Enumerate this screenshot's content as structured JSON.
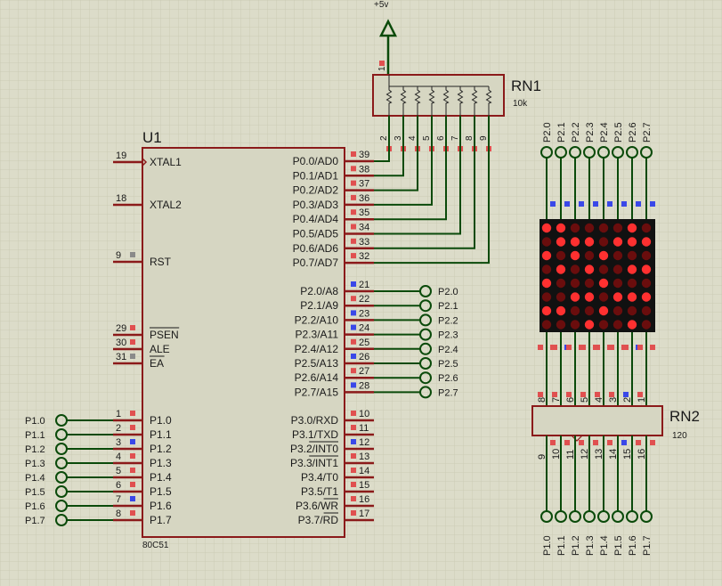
{
  "power": {
    "label": "+5v"
  },
  "u1": {
    "ref": "U1",
    "part": "80C51",
    "left_pins": [
      {
        "num": "19",
        "name": "XTAL1"
      },
      {
        "num": "18",
        "name": "XTAL2"
      },
      {
        "num": "9",
        "name": "RST"
      },
      {
        "num": "29",
        "name": "PSEN"
      },
      {
        "num": "30",
        "name": "ALE"
      },
      {
        "num": "31",
        "name": "EA"
      },
      {
        "num": "1",
        "name": "P1.0"
      },
      {
        "num": "2",
        "name": "P1.1"
      },
      {
        "num": "3",
        "name": "P1.2"
      },
      {
        "num": "4",
        "name": "P1.3"
      },
      {
        "num": "5",
        "name": "P1.4"
      },
      {
        "num": "6",
        "name": "P1.5"
      },
      {
        "num": "7",
        "name": "P1.6"
      },
      {
        "num": "8",
        "name": "P1.7"
      }
    ],
    "right_pins": [
      {
        "num": "39",
        "name": "P0.0/AD0"
      },
      {
        "num": "38",
        "name": "P0.1/AD1"
      },
      {
        "num": "37",
        "name": "P0.2/AD2"
      },
      {
        "num": "36",
        "name": "P0.3/AD3"
      },
      {
        "num": "35",
        "name": "P0.4/AD4"
      },
      {
        "num": "34",
        "name": "P0.5/AD5"
      },
      {
        "num": "33",
        "name": "P0.6/AD6"
      },
      {
        "num": "32",
        "name": "P0.7/AD7"
      },
      {
        "num": "21",
        "name": "P2.0/A8"
      },
      {
        "num": "22",
        "name": "P2.1/A9"
      },
      {
        "num": "23",
        "name": "P2.2/A10"
      },
      {
        "num": "24",
        "name": "P2.3/A11"
      },
      {
        "num": "25",
        "name": "P2.4/A12"
      },
      {
        "num": "26",
        "name": "P2.5/A13"
      },
      {
        "num": "27",
        "name": "P2.6/A14"
      },
      {
        "num": "28",
        "name": "P2.7/A15"
      },
      {
        "num": "10",
        "name": "P3.0/RXD"
      },
      {
        "num": "11",
        "name": "P3.1/TXD"
      },
      {
        "num": "12",
        "name": "P3.2/INT0"
      },
      {
        "num": "13",
        "name": "P3.3/INT1"
      },
      {
        "num": "14",
        "name": "P3.4/T0"
      },
      {
        "num": "15",
        "name": "P3.5/T1"
      },
      {
        "num": "16",
        "name": "P3.6/WR"
      },
      {
        "num": "17",
        "name": "P3.7/RD"
      }
    ]
  },
  "rn1": {
    "ref": "RN1",
    "value": "10k",
    "common_pin": "1",
    "pins": [
      "2",
      "3",
      "4",
      "5",
      "6",
      "7",
      "8",
      "9"
    ]
  },
  "rn2": {
    "ref": "RN2",
    "value": "120",
    "top_pins": [
      "8",
      "7",
      "6",
      "5",
      "4",
      "3",
      "2",
      "1"
    ],
    "bottom_pins": [
      "9",
      "10",
      "11",
      "12",
      "13",
      "14",
      "15",
      "16"
    ]
  },
  "p1_terminals": [
    "P1.0",
    "P1.1",
    "P1.2",
    "P1.3",
    "P1.4",
    "P1.5",
    "P1.6",
    "P1.7"
  ],
  "p2_terminals": [
    "P2.0",
    "P2.1",
    "P2.2",
    "P2.3",
    "P2.4",
    "P2.5",
    "P2.6",
    "P2.7"
  ],
  "matrix": {
    "rows": [
      [
        1,
        1,
        0,
        0,
        0,
        0,
        1,
        0
      ],
      [
        0,
        1,
        1,
        1,
        0,
        1,
        1,
        1
      ],
      [
        1,
        0,
        1,
        0,
        1,
        0,
        0,
        0
      ],
      [
        0,
        1,
        0,
        1,
        0,
        0,
        1,
        1
      ],
      [
        1,
        0,
        0,
        0,
        1,
        0,
        0,
        0
      ],
      [
        0,
        0,
        1,
        1,
        0,
        1,
        1,
        1
      ],
      [
        1,
        1,
        0,
        0,
        1,
        0,
        0,
        0
      ],
      [
        0,
        0,
        0,
        1,
        0,
        0,
        1,
        0
      ]
    ],
    "led_on_color": "#ff3030",
    "led_off_color": "#6a0d0d"
  },
  "colors": {
    "background": "#dcdcc9",
    "grid": "#cfcfba",
    "outline": "#8b1a1a",
    "chip_fill": "#d6d6c2",
    "wire": "#0a4a0a",
    "pin_red": "#e05050",
    "pin_blue": "#3a48e8",
    "pin_grey": "#8a8a8a"
  }
}
